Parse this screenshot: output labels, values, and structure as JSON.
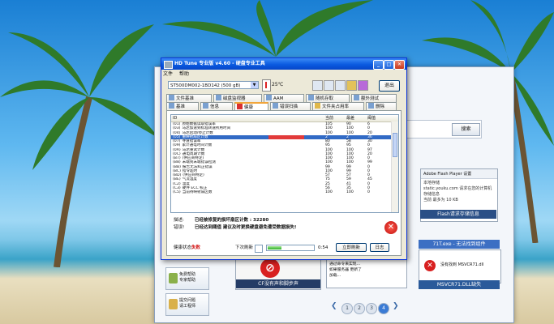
{
  "background_window": {
    "search_button": "搜索",
    "flash_panel": {
      "title": "Adobe Flash Player 设置",
      "lines": [
        "本地存储",
        "static.youku.com 请求在您的计算机",
        "存储信息",
        "当前 最多为 10 KB"
      ]
    },
    "banner_flash": "Flash请求存储信息",
    "banner_error_title": "71T.exe - 无法找到组件",
    "error_text": "没有找到 MSVCR71.dll",
    "banner_dll": "MSVCR71.DLL缺失",
    "thumb_caption": "CF没有声和脚步声",
    "thumb_text_lines": [
      "重装 Windows 并修改",
      "通过命令来实现...",
      "如果服务器 更新了",
      "加载..."
    ],
    "side_buttons": [
      {
        "label_lines": [
          "免费帮助",
          "专家帮助"
        ]
      },
      {
        "label_lines": [
          "提交问题",
          "请工程师"
        ]
      }
    ],
    "pager": [
      "1",
      "2",
      "3",
      "4"
    ]
  },
  "window": {
    "title": "HD Tune 专业版 v4.60 - 硬盘专业工具",
    "menu": [
      "文件",
      "帮助"
    ],
    "drive": "ST500DM002-1BD142 (500 gB)",
    "temperature": "25℃",
    "exit_label": "退出",
    "tabs_row1": [
      "文件基准",
      "磁盘监视器",
      "AAM",
      "随机存取",
      "额外测试"
    ],
    "tabs_row2": [
      "基准",
      "信息",
      "健康",
      "错误扫描",
      "文件夹占用率",
      "删除"
    ],
    "active_tab": "健康",
    "table": {
      "headers": [
        "ID",
        "当前",
        "最差",
        "阈值"
      ],
      "rows": [
        {
          "id": "(01)",
          "name": "原始数据读取错误率",
          "cur": "105",
          "worst": "90",
          "thr": "6"
        },
        {
          "id": "(03)",
          "name": "马达加速到标准转速所用时间",
          "cur": "100",
          "worst": "100",
          "thr": "0"
        },
        {
          "id": "(04)",
          "name": "马达启动/停止计数",
          "cur": "100",
          "worst": "100",
          "thr": "20"
        },
        {
          "id": "(05)",
          "name": "重映射扇区计数",
          "cur": "2",
          "worst": "2",
          "thr": "36",
          "selected": true
        },
        {
          "id": "(07)",
          "name": "寻道错误率",
          "cur": "80",
          "worst": "58",
          "thr": "30"
        },
        {
          "id": "(09)",
          "name": "累计通电时间计数",
          "cur": "95",
          "worst": "95",
          "thr": "0"
        },
        {
          "id": "(0A)",
          "name": "马达重试计数",
          "cur": "100",
          "worst": "100",
          "thr": "97"
        },
        {
          "id": "(0C)",
          "name": "通电周期计数",
          "cur": "100",
          "worst": "100",
          "thr": "20"
        },
        {
          "id": "(B7)",
          "name": "(供应商特定)",
          "cur": "100",
          "worst": "100",
          "thr": "0"
        },
        {
          "id": "(B8)",
          "name": "末端到末端错误检测",
          "cur": "100",
          "worst": "100",
          "thr": "99"
        },
        {
          "id": "(BB)",
          "name": "报告无法纠正错误",
          "cur": "99",
          "worst": "99",
          "thr": "0"
        },
        {
          "id": "(BC)",
          "name": "指令超时",
          "cur": "100",
          "worst": "99",
          "thr": "0"
        },
        {
          "id": "(BD)",
          "name": "(供应商特定)",
          "cur": "57",
          "worst": "57",
          "thr": "0"
        },
        {
          "id": "(BE)",
          "name": "气流温度",
          "cur": "75",
          "worst": "59",
          "thr": "45"
        },
        {
          "id": "(C2)",
          "name": "温度",
          "cur": "25",
          "worst": "41",
          "thr": "0"
        },
        {
          "id": "(C3)",
          "name": "硬件 ECC 校正",
          "cur": "56",
          "worst": "35",
          "thr": "0"
        },
        {
          "id": "(C5)",
          "name": "当前待映射扇区数",
          "cur": "100",
          "worst": "100",
          "thr": "0"
        }
      ]
    },
    "info": {
      "desc_label": "描述:",
      "desc_value": "已经被修复的损坏扇区计数 : 32280",
      "error_label": "错误!",
      "error_value": "已经达到阈值  建议及时更换硬盘避免遭受数据损失!"
    },
    "status": {
      "label": "健康状态 :",
      "value": "失败",
      "time_label": "下次刷新 :",
      "time_value": "0:54",
      "save_button": "立即刷新",
      "log_button": "日志",
      "progress": 0.3
    }
  }
}
